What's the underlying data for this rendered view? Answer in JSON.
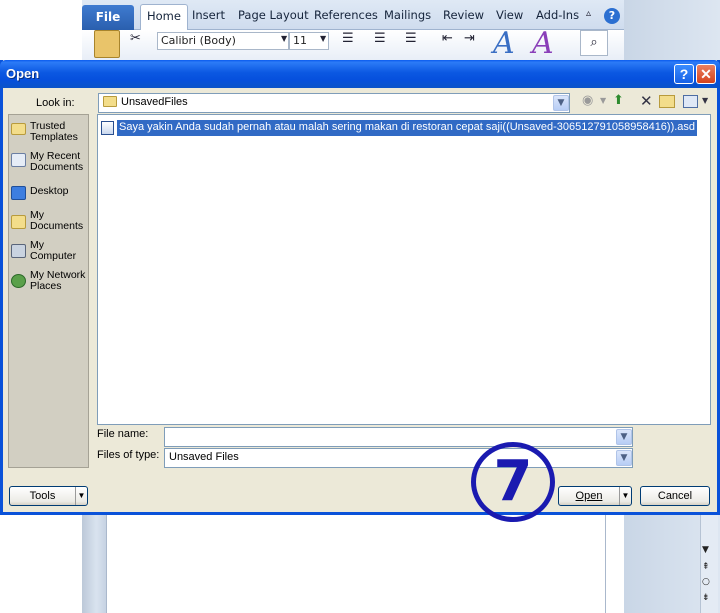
{
  "word": {
    "file_tab": "File",
    "tabs": [
      "Home",
      "Insert",
      "Page Layout",
      "References",
      "Mailings",
      "Review",
      "View",
      "Add-Ins"
    ],
    "font_name": "Calibri (Body)",
    "font_size": "11"
  },
  "dialog": {
    "title": "Open",
    "help_glyph": "?",
    "close_glyph": "✕",
    "look_in_label": "Look in:",
    "look_in_value": "UnsavedFiles",
    "places": [
      {
        "label": "Trusted Templates",
        "icon": "folder-star-icon"
      },
      {
        "label": "My Recent Documents",
        "icon": "recent-documents-icon"
      },
      {
        "label": "Desktop",
        "icon": "desktop-icon"
      },
      {
        "label": "My Documents",
        "icon": "my-documents-icon"
      },
      {
        "label": "My Computer",
        "icon": "my-computer-icon"
      },
      {
        "label": "My Network Places",
        "icon": "network-places-icon"
      }
    ],
    "files": [
      {
        "name": "Saya yakin Anda sudah pernah atau malah sering makan di restoran cepat saji((Unsaved-306512791058958416)).asd",
        "selected": true
      }
    ],
    "file_name_label": "File name:",
    "file_name_value": "",
    "files_of_type_label": "Files of type:",
    "files_of_type_value": "Unsaved Files",
    "tools_label": "Tools",
    "open_label": "Open",
    "cancel_label": "Cancel"
  },
  "annotation": {
    "step": "7",
    "color": "#1a1ab0"
  },
  "colors": {
    "titlebar": "#0a52d9",
    "selection": "#316ac5",
    "dialog_bg": "#ece9d8"
  }
}
